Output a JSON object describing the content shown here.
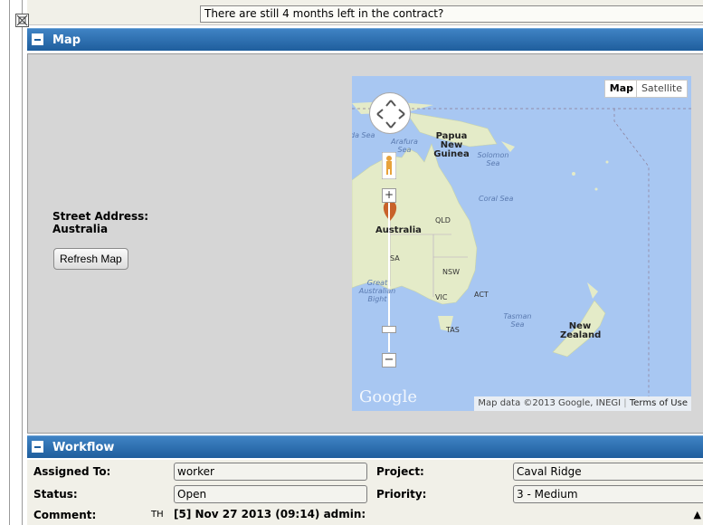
{
  "top": {
    "question_text": "There are still 4 months left in the contract?"
  },
  "map_section": {
    "title": "Map",
    "address_label": "Street Address:",
    "address_value": "Australia",
    "refresh_button": "Refresh Map",
    "map_type_options": [
      "Map",
      "Satellite"
    ],
    "selected_map_type": "Map",
    "attribution": "Map data ©2013 Google, INEGI",
    "terms_link": "Terms of Use",
    "logo_text": "Google",
    "places": {
      "arafura": "Arafura Sea",
      "banda": "da Sea",
      "png": "Papua New Guinea",
      "solomon": "Solomon Sea",
      "coral": "Coral Sea",
      "qld": "QLD",
      "australia": "Australia",
      "sa": "SA",
      "nsw": "NSW",
      "bight": "Great Australian Bight",
      "vic": "VIC",
      "act": "ACT",
      "tasman": "Tasman Sea",
      "tas": "TAS",
      "nz": "New Zealand"
    },
    "zoom_in": "+",
    "zoom_out": "−"
  },
  "workflow": {
    "title": "Workflow",
    "assigned_to_label": "Assigned To:",
    "assigned_to_value": "worker",
    "project_label": "Project:",
    "project_value": "Caval Ridge",
    "status_label": "Status:",
    "status_value": "Open",
    "priority_label": "Priority:",
    "priority_value": "3 - Medium",
    "comment_label": "Comment:",
    "comment_icons": "TH",
    "comment_text": "[5] Nov 27 2013 (09:14) admin:"
  },
  "colors": {
    "section_bar": "#2a6daf",
    "panel_bg": "#d6d6d6",
    "water": "#a8c7f2",
    "land": "#e4ebc8"
  }
}
